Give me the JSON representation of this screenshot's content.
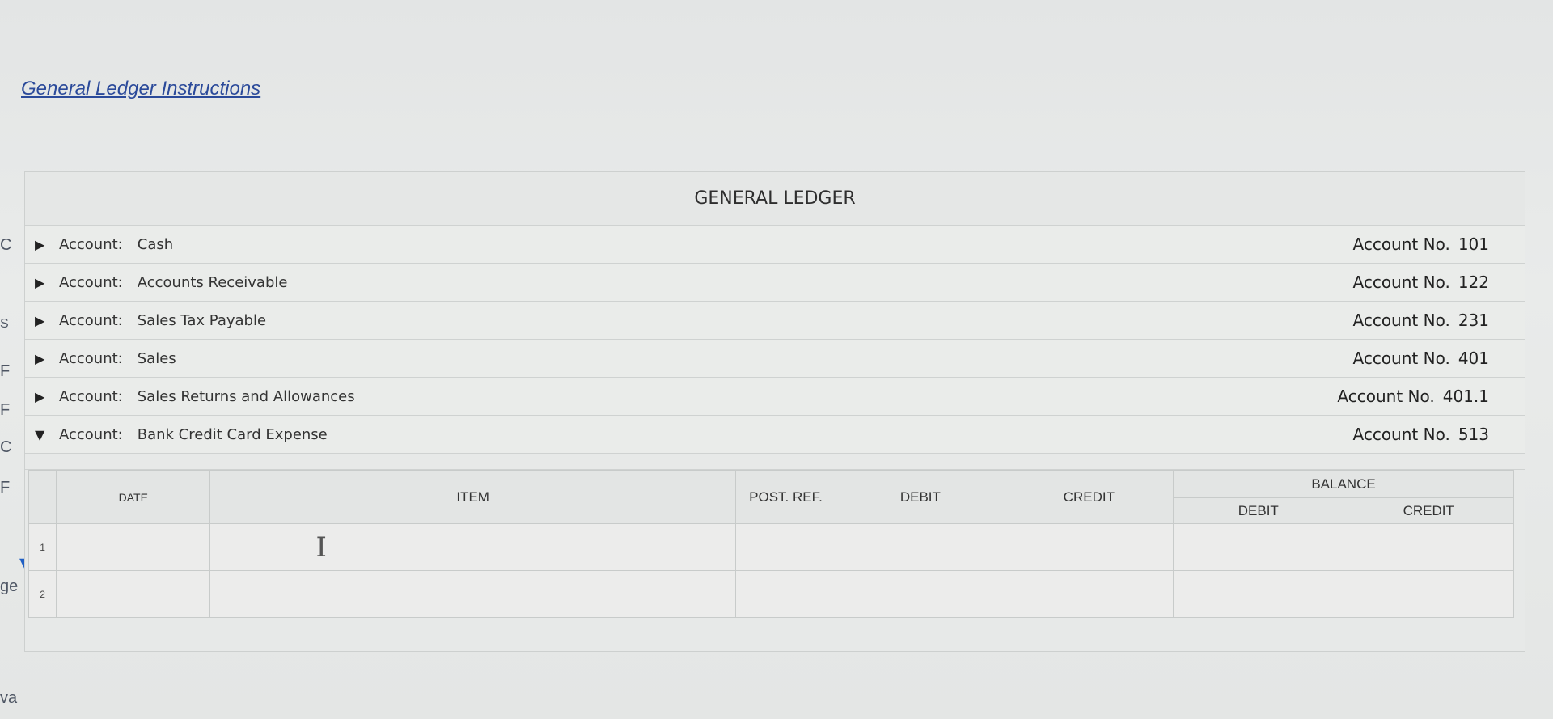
{
  "left_edge_letters": [
    "C",
    "S",
    "F",
    "F",
    "C",
    "F",
    "ge",
    "va"
  ],
  "instructions_link": "General Ledger Instructions",
  "ledger": {
    "title": "GENERAL LEDGER",
    "account_label": "Account:",
    "account_no_label": "Account No.",
    "accounts": [
      {
        "name": "Cash",
        "number": "101",
        "expanded": false
      },
      {
        "name": "Accounts Receivable",
        "number": "122",
        "expanded": false
      },
      {
        "name": "Sales Tax Payable",
        "number": "231",
        "expanded": false
      },
      {
        "name": "Sales",
        "number": "401",
        "expanded": false
      },
      {
        "name": "Sales Returns and Allowances",
        "number": "401.1",
        "expanded": false
      },
      {
        "name": "Bank Credit Card Expense",
        "number": "513",
        "expanded": true
      }
    ],
    "table": {
      "headers": {
        "date": "DATE",
        "item": "ITEM",
        "post_ref": "POST. REF.",
        "debit": "DEBIT",
        "credit": "CREDIT",
        "balance": "BALANCE",
        "balance_debit": "DEBIT",
        "balance_credit": "CREDIT"
      },
      "rows": [
        {
          "num": "1"
        },
        {
          "num": "2"
        }
      ]
    }
  },
  "icons": {
    "collapsed": "triangle-right-icon",
    "expanded": "triangle-down-icon",
    "cursor": "text-cursor-icon"
  }
}
